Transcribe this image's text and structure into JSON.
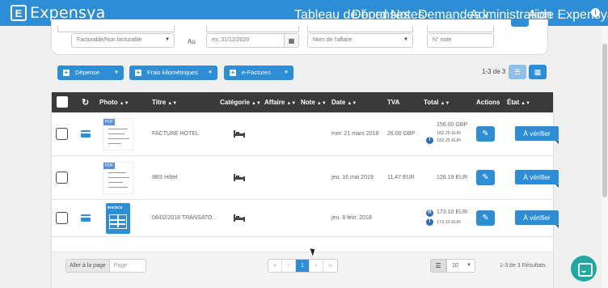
{
  "brand": {
    "logo_letter": "E",
    "name": "Expensya"
  },
  "nav": {
    "items": [
      {
        "label": "Tableau de bord"
      },
      {
        "label": "Dépenses"
      },
      {
        "label": "Notes"
      },
      {
        "label": "Demandes"
      },
      {
        "label": "Administration"
      },
      {
        "label": "Aide Expensya"
      }
    ],
    "active": "Dépenses"
  },
  "filters": {
    "billable_select": "Facturable/Non facturable",
    "au_label": "Au",
    "date_to_placeholder": "ex: 31/12/2020",
    "affaire_select": "Nom de l'affaire",
    "note_placeholder": "N° note"
  },
  "actions": {
    "depense_label": "Dépense",
    "km_label": "Frais kilométriques",
    "efactures_label": "e-Factures",
    "count_text": "1-3 de 3"
  },
  "table": {
    "headers": {
      "photo": "Photo",
      "titre": "Titre",
      "categorie": "Catégorie",
      "affaire": "Affaire",
      "note": "Note",
      "date": "Date",
      "tva": "TVA",
      "total": "Total",
      "actions": "Actions",
      "etat": "État"
    },
    "rows": [
      {
        "title": "FACTURE HOTEL",
        "date": "mer. 21 mars 2018",
        "tva": "26.00 GBP",
        "total_main": "156.00 GBP",
        "total_sub1": "182.25 EUR",
        "total_sub2": "182.25 EUR",
        "badge": "T",
        "status": "À vérifier"
      },
      {
        "title": "IBIS Hôtel",
        "date": "jeu. 16 mai 2019",
        "tva": "11.47 EUR",
        "total_main": "126.19 EUR",
        "status": "À vérifier"
      },
      {
        "title": "08/02/2018 TRANSATO...",
        "date": "jeu. 8 févr. 2018",
        "total_main": "173.10 EUR",
        "total_sub1": "173.10 EUR",
        "badge1": "R",
        "badge2": "T",
        "invoice_label": "INVOICE",
        "status": "À vérifier"
      }
    ]
  },
  "footer": {
    "goto_label": "Aller à la page",
    "goto_placeholder": "Page",
    "pages": [
      "«",
      "‹",
      "1",
      "›",
      "»"
    ],
    "per_page": "10",
    "results": "1-3 de 3 Résultats"
  },
  "colors": {
    "primary": "#2d8ed6",
    "header_dark": "#3a3a3a",
    "chat": "#22a8a0"
  }
}
